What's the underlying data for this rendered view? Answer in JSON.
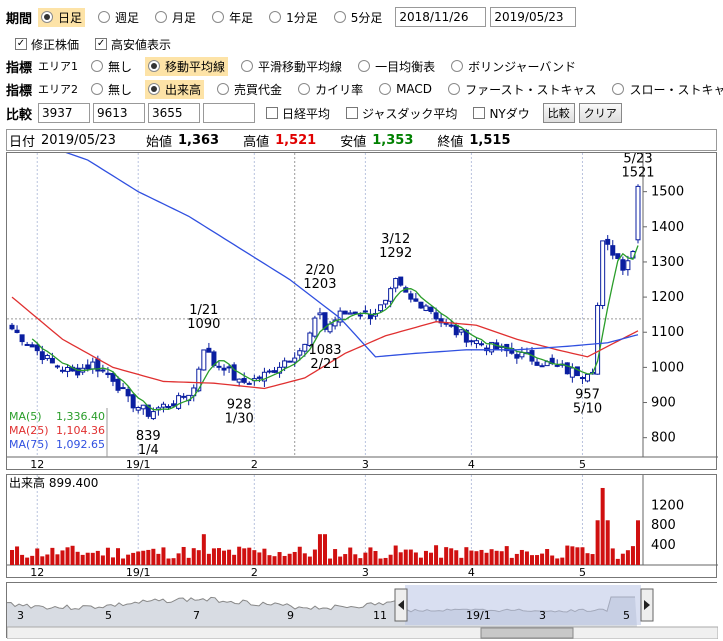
{
  "period": {
    "label": "期間",
    "options": [
      "日足",
      "週足",
      "月足",
      "年足",
      "1分足",
      "5分足"
    ],
    "selected": 0,
    "from": "2018/11/26",
    "to": "2019/05/23"
  },
  "checkboxes": [
    {
      "label": "修正株価",
      "checked": true
    },
    {
      "label": "高安値表示",
      "checked": true
    }
  ],
  "indicator1": {
    "label": "指標",
    "sub": "エリア1",
    "options": [
      "無し",
      "移動平均線",
      "平滑移動平均線",
      "一目均衡表",
      "ボリンジャーバンド"
    ],
    "selected": 1
  },
  "indicator2": {
    "label": "指標",
    "sub": "エリア2",
    "options": [
      "無し",
      "出来高",
      "売買代金",
      "カイリ率",
      "MACD",
      "ファースト・ストキャス",
      "スロー・ストキャス"
    ],
    "selected": 1
  },
  "compare": {
    "label": "比較",
    "codes": [
      "3937",
      "9613",
      "3655",
      ""
    ],
    "options": [
      "日経平均",
      "ジャスダック平均",
      "NYダウ"
    ],
    "compare_button": "比較",
    "clear_button": "クリア"
  },
  "info": {
    "date_label": "日付",
    "date": "2019/05/23",
    "open_label": "始値",
    "open": "1,363",
    "high_label": "高値",
    "high": "1,521",
    "low_label": "安値",
    "low": "1,353",
    "close_label": "終値",
    "close": "1,515"
  },
  "colors": {
    "high": "#e00000",
    "low": "#008000",
    "candle": "#0a1ea0",
    "ma5": "#2a9d2a",
    "ma25": "#e03030",
    "ma75": "#3050e0",
    "volume": "#d01010"
  },
  "chart_data": [
    {
      "type": "candlestick",
      "title": "",
      "y_ticks": [
        800,
        900,
        1000,
        1100,
        1200,
        1300,
        1400,
        1500
      ],
      "ylim": [
        745,
        1610
      ],
      "x_ticks": [
        {
          "label": "12",
          "i": 5
        },
        {
          "label": "19/1",
          "i": 25
        },
        {
          "label": "2",
          "i": 48
        },
        {
          "label": "3",
          "i": 70
        },
        {
          "label": "4",
          "i": 91
        },
        {
          "label": "5",
          "i": 113
        }
      ],
      "reference_line": 1138,
      "annotations": [
        {
          "text": "5/23",
          "text2": "1521",
          "i": 124,
          "v": 1521,
          "pos": "above"
        },
        {
          "text": "3/12",
          "text2": "1292",
          "i": 76,
          "v": 1292,
          "pos": "above"
        },
        {
          "text": "2/20",
          "text2": "1203",
          "i": 61,
          "v": 1203,
          "pos": "above"
        },
        {
          "text": "1/21",
          "text2": "1090",
          "i": 38,
          "v": 1090,
          "pos": "above"
        },
        {
          "text": "1083",
          "text2": "2/21",
          "i": 62,
          "v": 1083,
          "pos": "below"
        },
        {
          "text": "928",
          "text2": "1/30",
          "i": 45,
          "v": 928,
          "pos": "below"
        },
        {
          "text": "957",
          "text2": "5/10",
          "i": 114,
          "v": 957,
          "pos": "below"
        },
        {
          "text": "839",
          "text2": "1/4",
          "i": 27,
          "v": 839,
          "pos": "below"
        }
      ],
      "legend": [
        {
          "name": "MA(5)",
          "value": "1,336.40"
        },
        {
          "name": "MA(25)",
          "value": "1,104.36"
        },
        {
          "name": "MA(75)",
          "value": "1,092.65"
        }
      ],
      "close_anchors": [
        [
          0,
          1110
        ],
        [
          4,
          1060
        ],
        [
          8,
          1010
        ],
        [
          12,
          985
        ],
        [
          16,
          1010
        ],
        [
          20,
          970
        ],
        [
          23,
          905
        ],
        [
          27,
          870
        ],
        [
          30,
          890
        ],
        [
          33,
          905
        ],
        [
          36,
          940
        ],
        [
          38,
          1060
        ],
        [
          40,
          1010
        ],
        [
          42,
          1005
        ],
        [
          45,
          955
        ],
        [
          48,
          965
        ],
        [
          51,
          985
        ],
        [
          54,
          1020
        ],
        [
          58,
          1060
        ],
        [
          61,
          1160
        ],
        [
          62,
          1110
        ],
        [
          65,
          1150
        ],
        [
          68,
          1160
        ],
        [
          71,
          1150
        ],
        [
          74,
          1180
        ],
        [
          76,
          1240
        ],
        [
          79,
          1190
        ],
        [
          82,
          1180
        ],
        [
          85,
          1130
        ],
        [
          88,
          1100
        ],
        [
          91,
          1080
        ],
        [
          94,
          1060
        ],
        [
          98,
          1045
        ],
        [
          102,
          1030
        ],
        [
          106,
          1010
        ],
        [
          110,
          990
        ],
        [
          113,
          985
        ],
        [
          115,
          1000
        ],
        [
          117,
          1350
        ],
        [
          119,
          1330
        ],
        [
          121,
          1290
        ],
        [
          123,
          1330
        ],
        [
          124,
          1515
        ]
      ],
      "ma25_anchors": [
        [
          0,
          1200
        ],
        [
          10,
          1080
        ],
        [
          20,
          1000
        ],
        [
          30,
          960
        ],
        [
          40,
          955
        ],
        [
          50,
          940
        ],
        [
          58,
          970
        ],
        [
          66,
          1040
        ],
        [
          74,
          1090
        ],
        [
          84,
          1130
        ],
        [
          92,
          1120
        ],
        [
          100,
          1080
        ],
        [
          108,
          1050
        ],
        [
          114,
          1030
        ],
        [
          118,
          1060
        ],
        [
          124,
          1104
        ]
      ],
      "ma75_anchors": [
        [
          5,
          1640
        ],
        [
          15,
          1590
        ],
        [
          25,
          1500
        ],
        [
          35,
          1430
        ],
        [
          45,
          1340
        ],
        [
          55,
          1250
        ],
        [
          65,
          1140
        ],
        [
          72,
          1030
        ],
        [
          80,
          1040
        ],
        [
          90,
          1050
        ],
        [
          100,
          1050
        ],
        [
          110,
          1060
        ],
        [
          118,
          1070
        ],
        [
          124,
          1093
        ]
      ]
    },
    {
      "type": "bar",
      "title": "出来高",
      "value": "899.400",
      "y_ticks": [
        400,
        800,
        1200
      ],
      "ylim": [
        0,
        1650
      ],
      "x_ticks": [
        {
          "label": "12",
          "i": 5
        },
        {
          "label": "19/1",
          "i": 25
        },
        {
          "label": "2",
          "i": 48
        },
        {
          "label": "3",
          "i": 70
        },
        {
          "label": "4",
          "i": 91
        },
        {
          "label": "5",
          "i": 113
        }
      ]
    }
  ],
  "navigator": {
    "ticks": [
      "3",
      "5",
      "7",
      "9",
      "11",
      "19/1",
      "3",
      "5"
    ]
  }
}
